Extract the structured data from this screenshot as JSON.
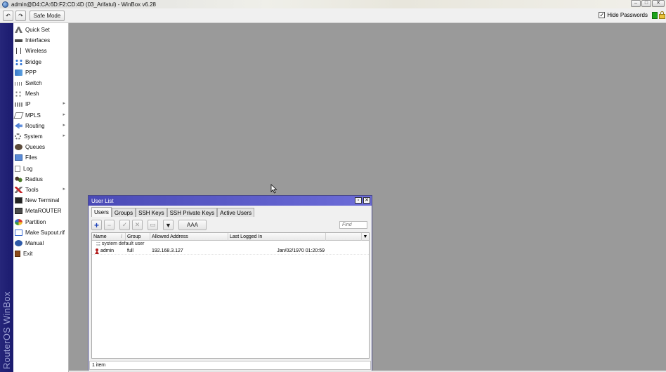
{
  "window": {
    "title": "admin@D4:CA:6D:F2:CD:4D (03_Arifatul) - WinBox v6.28",
    "controls": [
      "minimize",
      "maximize",
      "close"
    ]
  },
  "toolbar": {
    "undo_icon": "undo-icon",
    "redo_icon": "redo-icon",
    "safe_mode_label": "Safe Mode",
    "hide_passwords_label": "Hide Passwords",
    "hide_passwords_checked": true,
    "status_color": "#1aa31a"
  },
  "brand": {
    "vertical_text": "RouterOS WinBox",
    "color": "#26267a"
  },
  "sidebar": {
    "items": [
      {
        "label": "Quick Set",
        "icon": "quick-set-icon",
        "submenu": false
      },
      {
        "label": "Interfaces",
        "icon": "interfaces-icon",
        "submenu": false
      },
      {
        "label": "Wireless",
        "icon": "wireless-icon",
        "submenu": false
      },
      {
        "label": "Bridge",
        "icon": "bridge-icon",
        "submenu": false
      },
      {
        "label": "PPP",
        "icon": "ppp-icon",
        "submenu": false
      },
      {
        "label": "Switch",
        "icon": "switch-icon",
        "submenu": false
      },
      {
        "label": "Mesh",
        "icon": "mesh-icon",
        "submenu": false
      },
      {
        "label": "IP",
        "icon": "ip-icon",
        "submenu": true
      },
      {
        "label": "MPLS",
        "icon": "mpls-icon",
        "submenu": true
      },
      {
        "label": "Routing",
        "icon": "routing-icon",
        "submenu": true
      },
      {
        "label": "System",
        "icon": "system-icon",
        "submenu": true
      },
      {
        "label": "Queues",
        "icon": "queues-icon",
        "submenu": false
      },
      {
        "label": "Files",
        "icon": "files-icon",
        "submenu": false
      },
      {
        "label": "Log",
        "icon": "log-icon",
        "submenu": false
      },
      {
        "label": "Radius",
        "icon": "radius-icon",
        "submenu": false
      },
      {
        "label": "Tools",
        "icon": "tools-icon",
        "submenu": true
      },
      {
        "label": "New Terminal",
        "icon": "terminal-icon",
        "submenu": false
      },
      {
        "label": "MetaROUTER",
        "icon": "metarouter-icon",
        "submenu": false
      },
      {
        "label": "Partition",
        "icon": "partition-icon",
        "submenu": false
      },
      {
        "label": "Make Supout.rif",
        "icon": "supout-icon",
        "submenu": false
      },
      {
        "label": "Manual",
        "icon": "manual-icon",
        "submenu": false
      },
      {
        "label": "Exit",
        "icon": "exit-icon",
        "submenu": false
      }
    ]
  },
  "user_list": {
    "title": "User List",
    "tabs": [
      {
        "label": "Users",
        "active": true
      },
      {
        "label": "Groups",
        "active": false
      },
      {
        "label": "SSH Keys",
        "active": false
      },
      {
        "label": "SSH Private Keys",
        "active": false
      },
      {
        "label": "Active Users",
        "active": false
      }
    ],
    "toolbar": {
      "add_icon": "plus-icon",
      "remove_icon": "minus-icon",
      "enable_icon": "check-icon",
      "disable_icon": "x-icon",
      "comment_icon": "comment-icon",
      "filter_icon": "filter-icon",
      "aaa_label": "AAA",
      "find_placeholder": "Find"
    },
    "columns": [
      "Name",
      "Group",
      "Allowed Address",
      "Last Logged In"
    ],
    "sort_indicator": "/",
    "comment": ";;; system default user",
    "rows": [
      {
        "name": "admin",
        "group": "full",
        "allowed_address": "192.168.3.127",
        "last_logged_in": "Jan/02/1970 01:20:59"
      }
    ],
    "status": "1 item"
  }
}
